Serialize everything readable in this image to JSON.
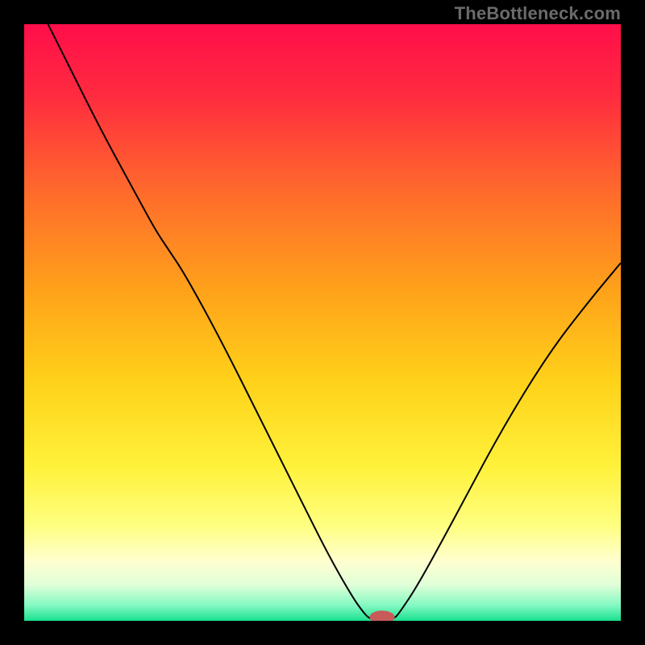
{
  "watermark": "TheBottleneck.com",
  "colors": {
    "frame": "#000000",
    "gradient_stops": [
      {
        "offset": 0.0,
        "color": "#ff0e4a"
      },
      {
        "offset": 0.12,
        "color": "#ff2b3f"
      },
      {
        "offset": 0.28,
        "color": "#ff6a2c"
      },
      {
        "offset": 0.45,
        "color": "#ffa31a"
      },
      {
        "offset": 0.6,
        "color": "#ffd21a"
      },
      {
        "offset": 0.74,
        "color": "#fff13a"
      },
      {
        "offset": 0.84,
        "color": "#ffff80"
      },
      {
        "offset": 0.9,
        "color": "#ffffd0"
      },
      {
        "offset": 0.94,
        "color": "#e0ffd8"
      },
      {
        "offset": 0.975,
        "color": "#80f8c0"
      },
      {
        "offset": 1.0,
        "color": "#18e08e"
      }
    ],
    "curve": "#000000",
    "marker_fill": "#c85a5a",
    "marker_stroke": "#c85a5a"
  },
  "chart_data": {
    "type": "line",
    "title": "",
    "xlabel": "",
    "ylabel": "",
    "xlim": [
      0,
      100
    ],
    "ylim": [
      0,
      100
    ],
    "optimum_x": 60,
    "curve": [
      {
        "x": 4.0,
        "y": 100.0
      },
      {
        "x": 8.0,
        "y": 92.0
      },
      {
        "x": 13.0,
        "y": 82.0
      },
      {
        "x": 19.0,
        "y": 71.0
      },
      {
        "x": 22.0,
        "y": 65.5
      },
      {
        "x": 24.0,
        "y": 62.5
      },
      {
        "x": 27.0,
        "y": 58.0
      },
      {
        "x": 33.0,
        "y": 47.0
      },
      {
        "x": 40.0,
        "y": 33.0
      },
      {
        "x": 46.0,
        "y": 21.0
      },
      {
        "x": 51.0,
        "y": 11.0
      },
      {
        "x": 55.0,
        "y": 4.0
      },
      {
        "x": 57.0,
        "y": 1.2
      },
      {
        "x": 58.0,
        "y": 0.3
      },
      {
        "x": 60.0,
        "y": 0.0
      },
      {
        "x": 62.0,
        "y": 0.3
      },
      {
        "x": 63.0,
        "y": 1.5
      },
      {
        "x": 66.0,
        "y": 6.0
      },
      {
        "x": 72.0,
        "y": 17.0
      },
      {
        "x": 80.0,
        "y": 32.0
      },
      {
        "x": 88.0,
        "y": 45.0
      },
      {
        "x": 95.0,
        "y": 54.0
      },
      {
        "x": 100.0,
        "y": 60.0
      }
    ],
    "marker": {
      "x": 60,
      "y": 0,
      "rx": 2.0,
      "ry": 1.0
    }
  }
}
